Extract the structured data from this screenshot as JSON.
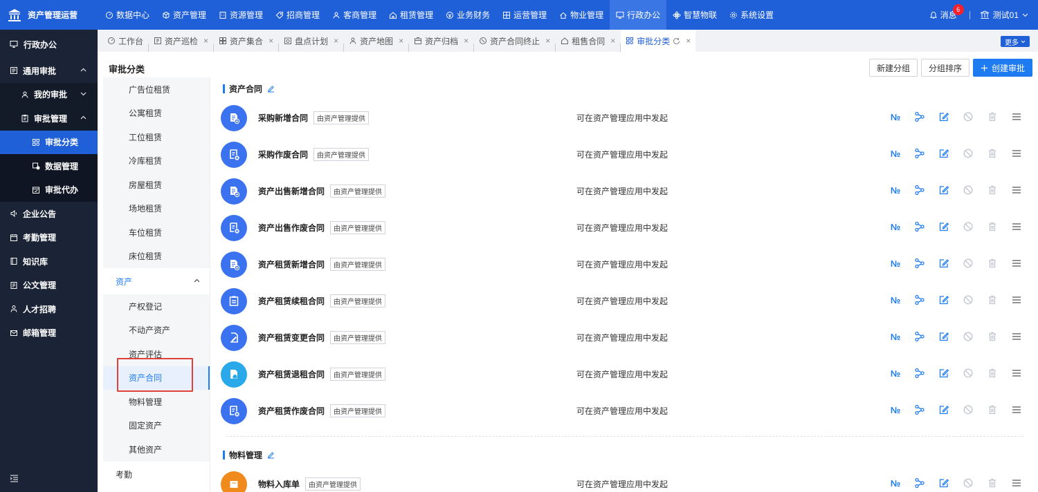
{
  "app": {
    "title": "资产管理运营"
  },
  "topnav": [
    {
      "label": "数据中心",
      "icon": "dashboard-icon"
    },
    {
      "label": "资产管理",
      "icon": "cube-icon"
    },
    {
      "label": "资源管理",
      "icon": "building-icon"
    },
    {
      "label": "招商管理",
      "icon": "tag-icon"
    },
    {
      "label": "客商管理",
      "icon": "users-icon"
    },
    {
      "label": "租赁管理",
      "icon": "house-icon"
    },
    {
      "label": "业务财务",
      "icon": "coin-icon"
    },
    {
      "label": "运营管理",
      "icon": "grid-icon"
    },
    {
      "label": "物业管理",
      "icon": "home-icon"
    },
    {
      "label": "行政办公",
      "icon": "monitor-icon",
      "active": true
    },
    {
      "label": "智慧物联",
      "icon": "atom-icon"
    },
    {
      "label": "系统设置",
      "icon": "gear-icon"
    }
  ],
  "header": {
    "messages_label": "消息",
    "messages_count": "6",
    "user_name": "测试01"
  },
  "sidebar": {
    "title": "行政办公",
    "items": [
      {
        "label": "通用审批",
        "level": 1,
        "expand": "up"
      },
      {
        "label": "我的审批",
        "level": 2,
        "expand": "down"
      },
      {
        "label": "审批管理",
        "level": 2,
        "expand": "up"
      },
      {
        "label": "审批分类",
        "level": 3,
        "active": true
      },
      {
        "label": "数据管理",
        "level": 3
      },
      {
        "label": "审批代办",
        "level": 3
      },
      {
        "label": "企业公告",
        "level": 1
      },
      {
        "label": "考勤管理",
        "level": 1
      },
      {
        "label": "知识库",
        "level": 1
      },
      {
        "label": "公文管理",
        "level": 1
      },
      {
        "label": "人才招聘",
        "level": 1
      },
      {
        "label": "邮箱管理",
        "level": 1
      }
    ]
  },
  "tabs": [
    {
      "label": "工作台",
      "closable": false
    },
    {
      "label": "资产巡检",
      "closable": true
    },
    {
      "label": "资产集合",
      "closable": true
    },
    {
      "label": "盘点计划",
      "closable": true
    },
    {
      "label": "资产地图",
      "closable": true
    },
    {
      "label": "资产归档",
      "closable": true
    },
    {
      "label": "资产合同终止",
      "closable": true
    },
    {
      "label": "租售合同",
      "closable": true
    },
    {
      "label": "审批分类",
      "closable": true,
      "active": true
    }
  ],
  "tabs_more": "更多",
  "page": {
    "title": "审批分类",
    "btn_new_group": "新建分组",
    "btn_sort_group": "分组排序",
    "btn_create": "创建审批"
  },
  "categories": {
    "top_subs": [
      "广告位租赁",
      "公寓租赁",
      "工位租赁",
      "冷库租赁",
      "房屋租赁",
      "场地租赁",
      "车位租赁",
      "床位租赁"
    ],
    "group_asset": "资产",
    "asset_subs": [
      "产权登记",
      "不动产资产",
      "资产评估",
      "资产合同",
      "物料管理",
      "固定资产",
      "其他资产"
    ],
    "active": "资产合同",
    "group_attendance": "考勤"
  },
  "sections": [
    {
      "title": "资产合同",
      "rows": [
        {
          "name": "采购新增合同",
          "tag": "由资产管理提供",
          "desc": "可在资产管理应用中发起",
          "icon": "doc-add-icon",
          "color": "#3b72f0"
        },
        {
          "name": "采购作废合同",
          "tag": "由资产管理提供",
          "desc": "可在资产管理应用中发起",
          "icon": "doc-cancel-icon",
          "color": "#3b72f0"
        },
        {
          "name": "资产出售新增合同",
          "tag": "由资产管理提供",
          "desc": "可在资产管理应用中发起",
          "icon": "doc-add-icon",
          "color": "#3b72f0"
        },
        {
          "name": "资产出售作废合同",
          "tag": "由资产管理提供",
          "desc": "可在资产管理应用中发起",
          "icon": "doc-cancel-icon",
          "color": "#3b72f0"
        },
        {
          "name": "资产租赁新增合同",
          "tag": "由资产管理提供",
          "desc": "可在资产管理应用中发起",
          "icon": "doc-add-icon",
          "color": "#3b72f0"
        },
        {
          "name": "资产租赁续租合同",
          "tag": "由资产管理提供",
          "desc": "可在资产管理应用中发起",
          "icon": "clipboard-icon",
          "color": "#3b72f0"
        },
        {
          "name": "资产租赁变更合同",
          "tag": "由资产管理提供",
          "desc": "可在资产管理应用中发起",
          "icon": "doc-edit-icon",
          "color": "#3b72f0"
        },
        {
          "name": "资产租赁退租合同",
          "tag": "由资产管理提供",
          "desc": "可在资产管理应用中发起",
          "icon": "doc-home-icon",
          "color": "#29a8ea"
        },
        {
          "name": "资产租赁作废合同",
          "tag": "由资产管理提供",
          "desc": "可在资产管理应用中发起",
          "icon": "doc-cancel-icon",
          "color": "#3b72f0"
        }
      ]
    },
    {
      "title": "物料管理",
      "rows": [
        {
          "name": "物料入库单",
          "tag": "由资产管理提供",
          "desc": "可在资产管理应用中发起",
          "icon": "box-icon",
          "color": "#f08a1c"
        }
      ]
    }
  ],
  "row_actions": [
    {
      "name": "number-icon",
      "glyph": "№",
      "disabled": false
    },
    {
      "name": "flow-icon",
      "glyph": "",
      "disabled": false
    },
    {
      "name": "edit-icon",
      "glyph": "",
      "disabled": false
    },
    {
      "name": "disable-icon",
      "glyph": "",
      "disabled": true
    },
    {
      "name": "delete-icon",
      "glyph": "",
      "disabled": true
    },
    {
      "name": "menu-icon",
      "glyph": "",
      "disabled": false
    }
  ],
  "colors": {
    "brand": "#1f5fd8",
    "accent": "#1f7cf0",
    "sidebar_bg": "#1b2336",
    "highlight": "#e0403a"
  }
}
